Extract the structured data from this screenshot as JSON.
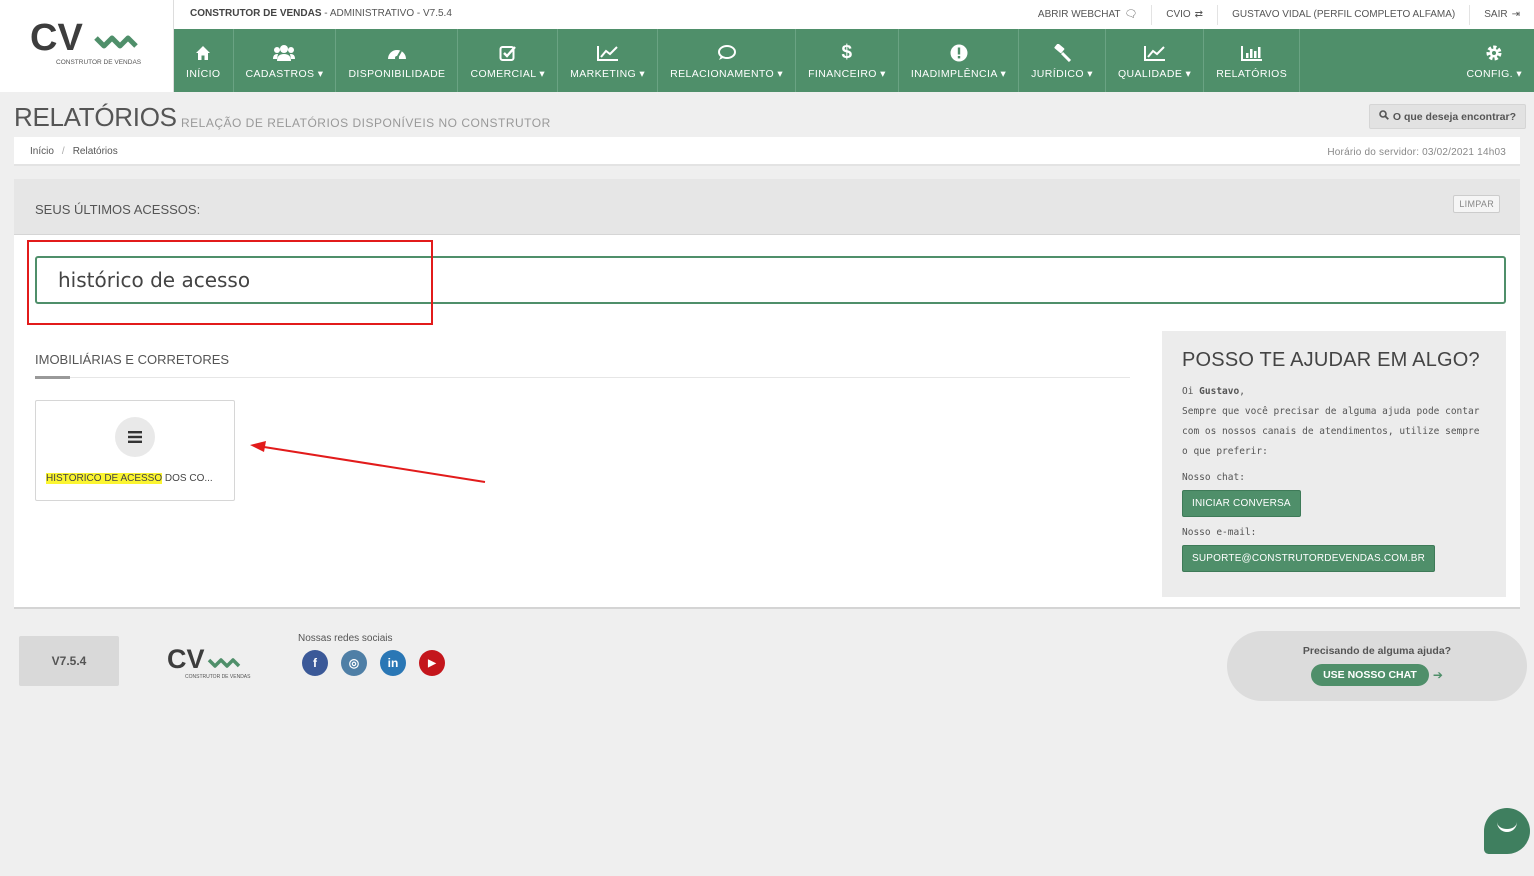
{
  "brand": {
    "logo_text": "CV",
    "logo_tagline": "CONSTRUTOR DE VENDAS",
    "color_primary": "#4f8f6a"
  },
  "topbar": {
    "app_name": "CONSTRUTOR DE VENDAS",
    "app_suffix": " - ADMINISTRATIVO - V7.5.4",
    "links": [
      {
        "label": "ABRIR WEBCHAT",
        "icon": "comments-icon"
      },
      {
        "label": "CVIO",
        "icon": "exchange-icon"
      },
      {
        "label": "GUSTAVO VIDAL (PERFIL COMPLETO ALFAMA)",
        "icon": ""
      },
      {
        "label": "SAIR",
        "icon": "sign-out-icon"
      }
    ]
  },
  "nav": {
    "items": [
      {
        "label": "INÍCIO",
        "icon": "home-icon"
      },
      {
        "label": "CADASTROS ▾",
        "icon": "users-icon"
      },
      {
        "label": "DISPONIBILIDADE",
        "icon": "dashboard-icon"
      },
      {
        "label": "COMERCIAL ▾",
        "icon": "check-square-icon"
      },
      {
        "label": "MARKETING ▾",
        "icon": "line-chart-icon"
      },
      {
        "label": "RELACIONAMENTO ▾",
        "icon": "comments-icon"
      },
      {
        "label": "FINANCEIRO ▾",
        "icon": "dollar-icon"
      },
      {
        "label": "INADIMPLÊNCIA ▾",
        "icon": "exclamation-circle-icon"
      },
      {
        "label": "JURÍDICO ▾",
        "icon": "gavel-icon"
      },
      {
        "label": "QUALIDADE ▾",
        "icon": "area-chart-icon"
      },
      {
        "label": "RELATÓRIOS",
        "icon": "bar-chart-icon"
      }
    ],
    "config_label": "CONFIG. ▾"
  },
  "page": {
    "title": "RELATÓRIOS",
    "subtitle": "RELAÇÃO DE RELATÓRIOS DISPONÍVEIS NO CONSTRUTOR",
    "search_button": "O que deseja encontrar?"
  },
  "breadcrumb": {
    "home": "Início",
    "current": "Relatórios",
    "server_time": "Horário do servidor: 03/02/2021 14h03"
  },
  "recent": {
    "title": "SEUS ÚLTIMOS ACESSOS:",
    "clear_button": "LIMPAR"
  },
  "search": {
    "value": "histórico de acesso"
  },
  "section": {
    "title": "IMOBILIÁRIAS E CORRETORES",
    "card_highlight": "HISTÓRICO DE ACESSO",
    "card_rest": " DOS CO..."
  },
  "help": {
    "title": "POSSO TE AJUDAR EM ALGO?",
    "greeting_prefix": "Oi ",
    "greeting_name": "Gustavo",
    "greeting_suffix": ",",
    "body": "Sempre que você precisar de alguma ajuda pode contar com os nossos canais de atendimentos, utilize sempre o que preferir:",
    "chat_label": "Nosso chat:",
    "chat_button": "INICIAR CONVERSA",
    "email_label": "Nosso e-mail:",
    "email_button": "SUPORTE@CONSTRUTORDEVENDAS.COM.BR"
  },
  "footer": {
    "version": "V7.5.4",
    "social_title": "Nossas redes sociais",
    "social": [
      {
        "name": "facebook",
        "glyph": "f",
        "color": "#3b5998"
      },
      {
        "name": "instagram",
        "glyph": "◎",
        "color": "#4f7fa6"
      },
      {
        "name": "linkedin",
        "glyph": "in",
        "color": "#2a77b5"
      },
      {
        "name": "youtube",
        "glyph": "▶",
        "color": "#c4161c"
      }
    ],
    "help_title": "Precisando de alguma ajuda?",
    "help_button": "USE NOSSO CHAT"
  }
}
